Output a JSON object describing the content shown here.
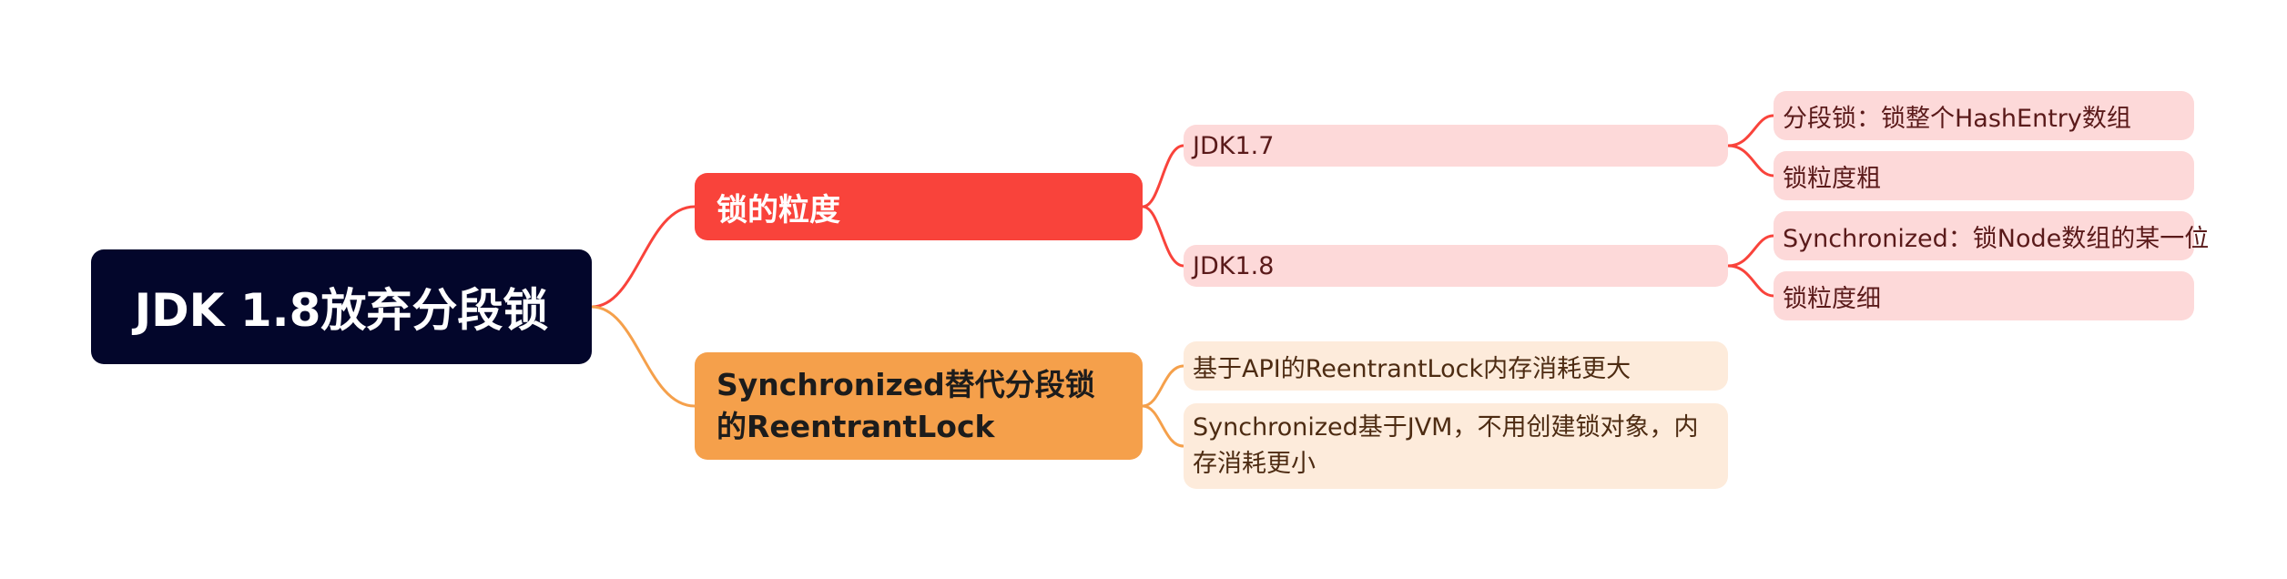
{
  "root": {
    "label": "JDK 1.8放弃分段锁"
  },
  "branches": {
    "granularity": {
      "label": "锁的粒度",
      "color": "#f9433b",
      "jdk17": {
        "label": "JDK1.7",
        "children": [
          "分段锁：锁整个HashEntry数组",
          "锁粒度粗"
        ]
      },
      "jdk18": {
        "label": "JDK1.8",
        "children": [
          "Synchronized：锁Node数组的某一位",
          "锁粒度细"
        ]
      }
    },
    "replacement": {
      "label": "Synchronized替代分段锁的ReentrantLock",
      "color": "#f5a04b",
      "children": [
        "基于API的ReentrantLock内存消耗更大",
        "Synchronized基于JVM，不用创建锁对象，内存消耗更小"
      ]
    }
  }
}
